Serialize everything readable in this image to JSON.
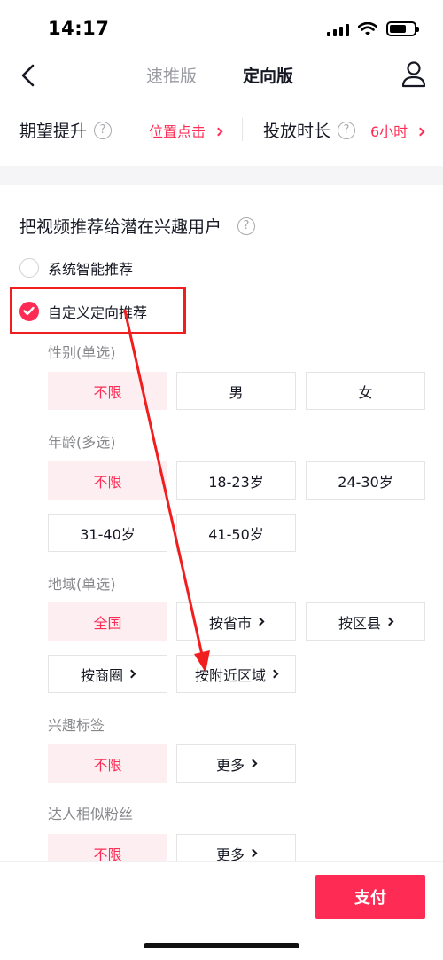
{
  "status_bar": {
    "time": "14:17"
  },
  "nav": {
    "tabs": [
      {
        "label": "速推版",
        "active": false
      },
      {
        "label": "定向版",
        "active": true
      }
    ]
  },
  "budget": {
    "expect_label": "期望提升",
    "expect_value": "位置点击",
    "duration_label": "投放时长",
    "duration_value": "6小时"
  },
  "audience": {
    "title": "把视频推荐给潜在兴趣用户",
    "options": [
      {
        "label": "系统智能推荐",
        "checked": false
      },
      {
        "label": "自定义定向推荐",
        "checked": true
      }
    ]
  },
  "targeting": {
    "gender": {
      "label": "性别(单选)",
      "options": [
        "不限",
        "男",
        "女"
      ],
      "selected": "不限"
    },
    "age": {
      "label": "年龄(多选)",
      "options": [
        "不限",
        "18-23岁",
        "24-30岁",
        "31-40岁",
        "41-50岁"
      ],
      "selected": "不限"
    },
    "region": {
      "label": "地域(单选)",
      "options": [
        "全国",
        "按省市",
        "按区县",
        "按商圈",
        "按附近区域"
      ],
      "selected": "全国"
    },
    "interest": {
      "label": "兴趣标签",
      "options": [
        "不限",
        "更多"
      ],
      "selected": "不限"
    },
    "similar_fans": {
      "label": "达人相似粉丝",
      "options": [
        "不限",
        "更多"
      ],
      "selected": "不限"
    }
  },
  "footer": {
    "pay_label": "支付"
  },
  "colors": {
    "accent": "#fe2c55",
    "selected_bg": "#fdeef1",
    "annotation_red": "#f01e1e"
  },
  "icons": [
    "back-icon",
    "user-icon",
    "help-icon",
    "chevron-right-icon",
    "check-icon"
  ]
}
